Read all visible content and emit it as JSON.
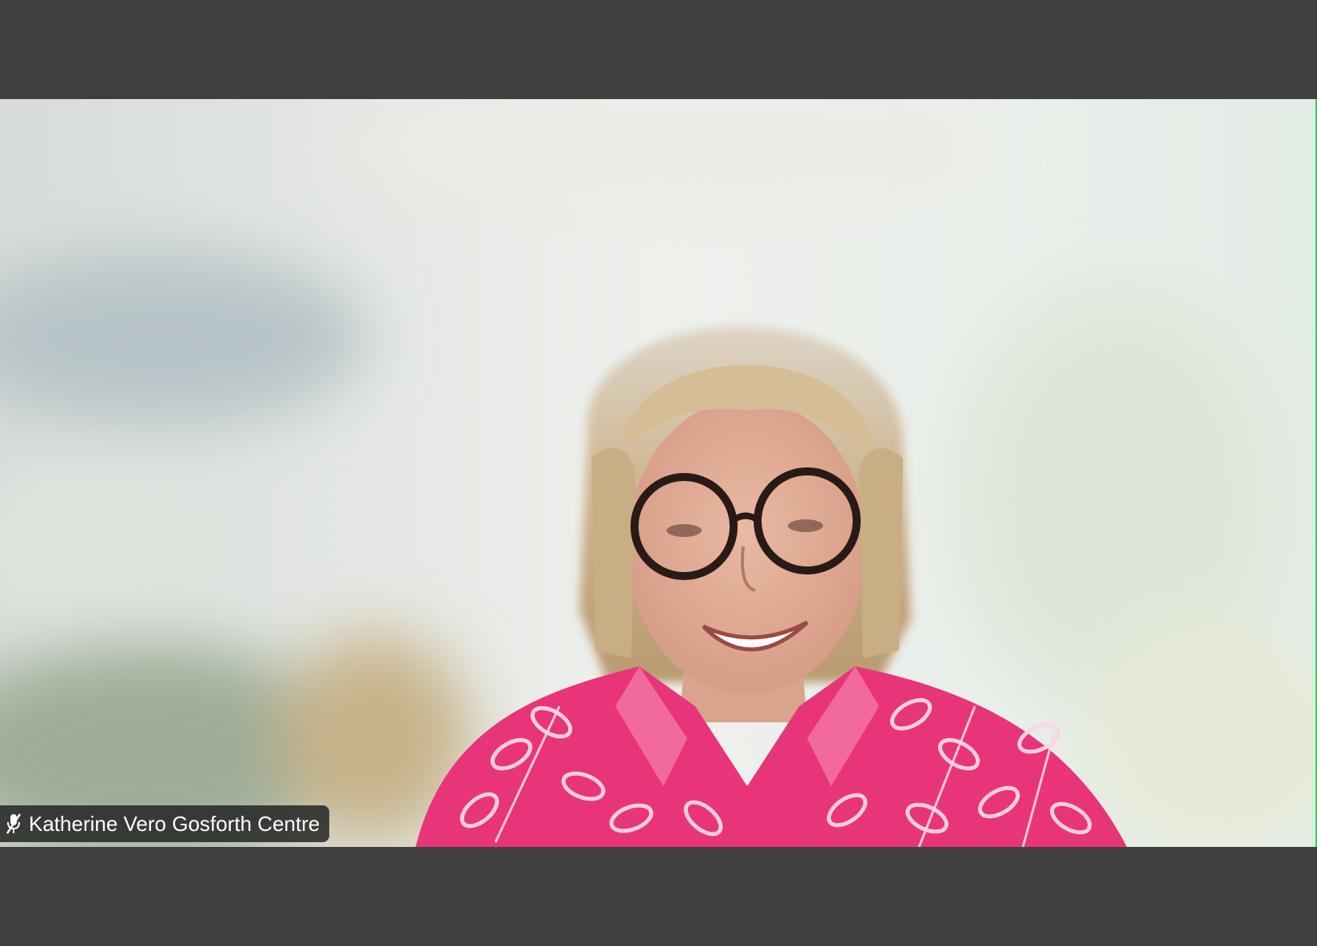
{
  "meeting": {
    "participant": {
      "name": "Katherine Vero Gosforth Centre",
      "mic_icon": "mic-muted-icon",
      "active_speaker": true
    },
    "colors": {
      "window_background": "#3f3f3f",
      "active_speaker_border": "#2fd15a",
      "label_background": "#1e1e1e",
      "label_text": "#ffffff",
      "shirt": "#e8357a",
      "hair": "#c9ad84"
    }
  }
}
